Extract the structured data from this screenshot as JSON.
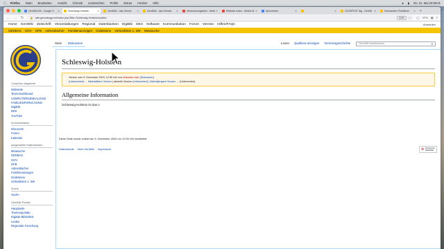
{
  "menubar": {
    "items": [
      "Firefox",
      "Datei",
      "Bearbeiten",
      "Ansicht",
      "Chronik",
      "Lesezeichen",
      "Profile",
      "Extras",
      "Fenster",
      "Hilfe"
    ],
    "clock": "Do. 21. Mai 20:09:01"
  },
  "browser": {
    "tabs": [
      {
        "label": "GenWiki.69 - Google S",
        "color": "#4285f4"
      },
      {
        "label": "Schleswig-Holstein",
        "color": "#f5c400"
      },
      {
        "label": "GenWiki - das Genea",
        "color": "#f5c400"
      },
      {
        "label": "GenWiki - das Geneal",
        "color": "#f5c400"
      },
      {
        "label": "Versionsvergleichs - Medi",
        "color": "#e8453c"
      },
      {
        "label": "Release notes - Media W",
        "color": "#e8453c"
      },
      {
        "label": "@ovomeen",
        "color": "#4285f4"
      },
      {
        "label": "",
        "color": "#f5c400"
      },
      {
        "label": "GOVEROS Tag - GenWi",
        "color": "#f5c400"
      },
      {
        "label": "Schmander (Familienn",
        "color": "#f5c400"
      }
    ],
    "url": "wiki.genealogy.net/index.php?title=Schleswig-Holstein&oldid=",
    "zoom": "110%",
    "ext_label": "VPN"
  },
  "site": {
    "nav": [
      "Home",
      "GenWiki",
      "Zeitschrift",
      "Veranstaltungen",
      "Regional",
      "Datenbanken",
      "DigiBib",
      "DES",
      "Software",
      "Kommunikation",
      "Forum",
      "Vereine",
      "Hilfen/FAQs"
    ],
    "login": "Anmelden",
    "subnav": [
      "GEDBAS",
      "GOV",
      "OFB",
      "Adressbücher",
      "Familienanzeigen",
      "Grabsteine",
      "Verlustlisten 1. WK",
      "Metasuche"
    ]
  },
  "page_tabs": {
    "left": [
      "Seite",
      "Diskussion"
    ],
    "right": [
      "Lesen",
      "Quelltext anzeigen",
      "Versionsgeschichte"
    ],
    "search_placeholder": "GenWiki durchsuchen"
  },
  "sidebar": [
    {
      "heading": "CompGen-Angebote",
      "links": [
        "Webseite",
        "Team-Dashboard",
        "COMPUTERGENEALOGIE",
        "FAMILIENFORSCHUNG",
        "DigiBib",
        "DES",
        "YouTube"
      ]
    },
    {
      "heading": "Kommunikation",
      "links": [
        "Discourse",
        "Forum",
        "Kalender"
      ]
    },
    {
      "heading": "ausgewählte Datenbanken",
      "links": [
        "Metasuche",
        "GEDBAS",
        "GOV",
        "OFB",
        "Adressbücher",
        "Familienanzeigen",
        "Grabsteine",
        "Verlustlisten 1. WK"
      ]
    },
    {
      "heading": "Suche",
      "links": [
        "Suche"
      ]
    },
    {
      "heading": "GenWiki-Portale",
      "links": [
        "Hauptseite",
        "Themenportale",
        "Digitale Bibliothek",
        "Lexika",
        "Regionale Forschung"
      ]
    }
  ],
  "content": {
    "title": "Schleswig-Holstein",
    "revision": {
      "line1_prefix": "Version vom 5. Dezember 2003, 12:59 Uhr von ",
      "user": "Unknown user",
      "talk": "Diskussion",
      "line2_a": "(Unterschied) ← Nächstältere Version",
      "line2_b": " | aktuelle Version ",
      "line2_c": "(Unterschied) | Nächstjüngere Version →",
      "line2_d": " (Unterschied)"
    },
    "section_heading": "Allgemeine Information",
    "body_text": "Schleswig-Holstein ist das n"
  },
  "footer": {
    "last_modified": "Diese Seite wurde zuletzt am 5. Dezember 2003 um 12:59 Uhr bearbeitet.",
    "links": [
      "Datenschutz",
      "Über GenWiki",
      "Impressum"
    ],
    "powered_line1": "Powered by",
    "powered_line2": "MediaWiki"
  },
  "colors": {
    "accent_yellow": "#f5c400",
    "link_blue": "#0645ad"
  }
}
